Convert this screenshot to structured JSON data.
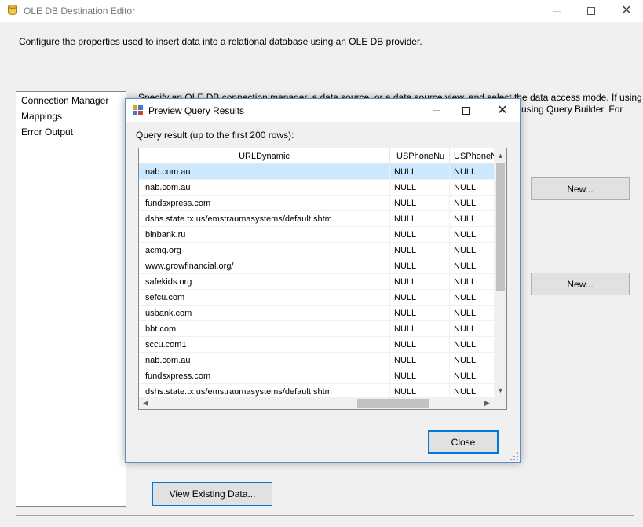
{
  "window": {
    "title": "OLE DB Destination Editor",
    "description": "Configure the properties used to insert data into a relational database using an OLE DB provider."
  },
  "sidebar": {
    "items": [
      {
        "label": "Connection Manager"
      },
      {
        "label": "Mappings"
      },
      {
        "label": "Error Output"
      }
    ]
  },
  "main": {
    "intro_line1": "Specify an OLE DB connection manager, a data source, or a data source view, and select the data access mode. If using",
    "intro_line2": "using Query Builder. For",
    "new_button_1": "New...",
    "new_button_2": "New...",
    "view_existing_button": "View Existing Data..."
  },
  "dialog": {
    "title": "Preview Query Results",
    "query_label": "Query result (up to the first 200 rows):",
    "columns": [
      "URLDynamic",
      "USPhoneNu",
      "USPhoneN"
    ],
    "rows": [
      [
        "nab.com.au",
        "NULL",
        "NULL"
      ],
      [
        "nab.com.au",
        "NULL",
        "NULL"
      ],
      [
        "fundsxpress.com",
        "NULL",
        "NULL"
      ],
      [
        "dshs.state.tx.us/emstraumasystems/default.shtm",
        "NULL",
        "NULL"
      ],
      [
        "binbank.ru",
        "NULL",
        "NULL"
      ],
      [
        "acmq.org",
        "NULL",
        "NULL"
      ],
      [
        "www.growfinancial.org/",
        "NULL",
        "NULL"
      ],
      [
        "safekids.org",
        "NULL",
        "NULL"
      ],
      [
        "sefcu.com",
        "NULL",
        "NULL"
      ],
      [
        "usbank.com",
        "NULL",
        "NULL"
      ],
      [
        "bbt.com",
        "NULL",
        "NULL"
      ],
      [
        "sccu.com1",
        "NULL",
        "NULL"
      ],
      [
        "nab.com.au",
        "NULL",
        "NULL"
      ],
      [
        "fundsxpress.com",
        "NULL",
        "NULL"
      ],
      [
        "dshs.state.tx.us/emstraumasystems/default.shtm",
        "NULL",
        "NULL"
      ]
    ],
    "selected_row": 0,
    "close_button": "Close"
  },
  "colors": {
    "selection": "#cce8ff",
    "focus_border": "#0078d7",
    "button_face": "#e1e1e1"
  }
}
